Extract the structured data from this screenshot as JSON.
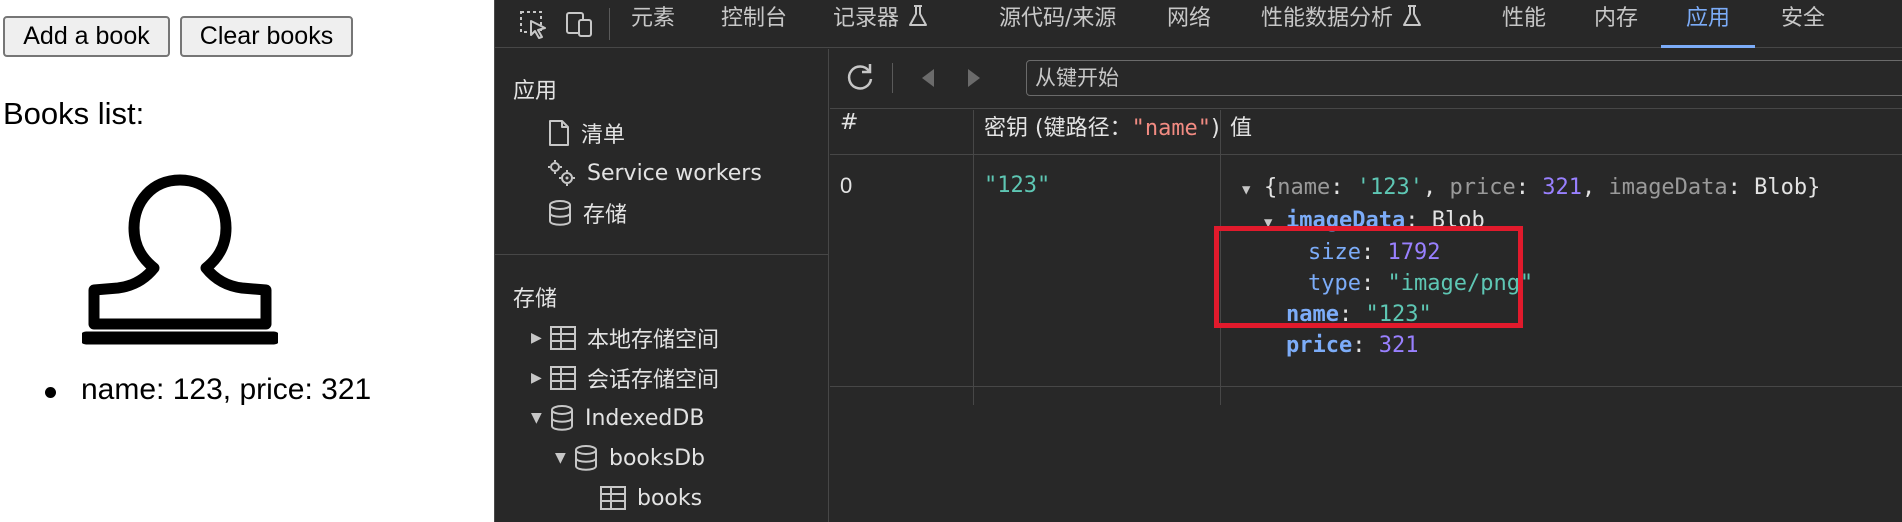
{
  "page": {
    "add_button": "Add a book",
    "clear_button": "Clear books",
    "books_title": "Books list:",
    "books": [
      {
        "text": "name: 123, price: 321"
      }
    ]
  },
  "devtools": {
    "tabs": [
      {
        "label": "元素"
      },
      {
        "label": "控制台"
      },
      {
        "label": "记录器"
      },
      {
        "label": "源代码/来源"
      },
      {
        "label": "网络"
      },
      {
        "label": "性能数据分析"
      },
      {
        "label": "性能"
      },
      {
        "label": "内存"
      },
      {
        "label": "应用"
      },
      {
        "label": "安全"
      }
    ],
    "active_tab": "应用",
    "sidebar": {
      "app_heading": "应用",
      "manifest": "清单",
      "service_workers": "Service workers",
      "storage_item": "存储",
      "storage_heading": "存储",
      "local_storage": "本地存储空间",
      "session_storage": "会话存储空间",
      "indexeddb": "IndexedDB",
      "db_name": "booksDb",
      "store_name": "books"
    },
    "toolbar": {
      "key_placeholder": "从键开始"
    },
    "grid": {
      "col_index": "#",
      "col_key_prefix": "密钥 (键路径：",
      "col_key_path": "\"name\"",
      "col_key_suffix": ")",
      "col_value": "值",
      "rows": [
        {
          "index": "0",
          "key": "\"123\"",
          "summary": {
            "open": "{",
            "name_key": "name",
            "name_val": "'123'",
            "price_key": "price",
            "price_val": "321",
            "image_key": "imageData",
            "image_val": "Blob",
            "close": "}"
          },
          "image_data": {
            "label": "imageData",
            "type_name": "Blob",
            "size_key": "size",
            "size_val": "1792",
            "type_key": "type",
            "type_val": "\"image/png\""
          },
          "name_key": "name",
          "name_val": "\"123\"",
          "price_key": "price",
          "price_val": "321"
        }
      ]
    },
    "colors": {
      "background": "#282828",
      "accent": "#7cacf8",
      "highlight_box": "#e11a2c",
      "string": "#5cd5fb",
      "number": "#9980ff"
    }
  },
  "icons": {
    "stamp": "stamp-icon",
    "inspect": "inspect-element-icon",
    "device": "device-toolbar-icon",
    "refresh": "refresh-icon",
    "prev": "previous-arrow-icon",
    "next": "next-arrow-icon"
  }
}
